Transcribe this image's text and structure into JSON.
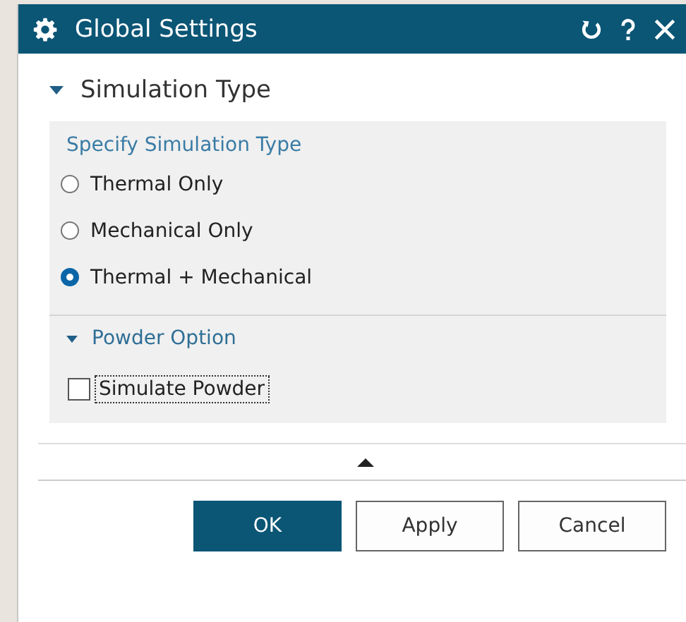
{
  "window": {
    "title": "Global Settings"
  },
  "section": {
    "title": "Simulation Type",
    "expanded": true,
    "group": {
      "label": "Specify Simulation Type",
      "options": [
        {
          "label": "Thermal Only",
          "selected": false
        },
        {
          "label": "Mechanical Only",
          "selected": false
        },
        {
          "label": "Thermal + Mechanical",
          "selected": true
        }
      ]
    },
    "subsection": {
      "title": "Powder Option",
      "expanded": true,
      "checkbox": {
        "label": "Simulate Powder",
        "checked": false,
        "focused": true
      }
    }
  },
  "buttons": [
    {
      "label": "OK",
      "default": true
    },
    {
      "label": "Apply",
      "default": false
    },
    {
      "label": "Cancel",
      "default": false
    }
  ]
}
